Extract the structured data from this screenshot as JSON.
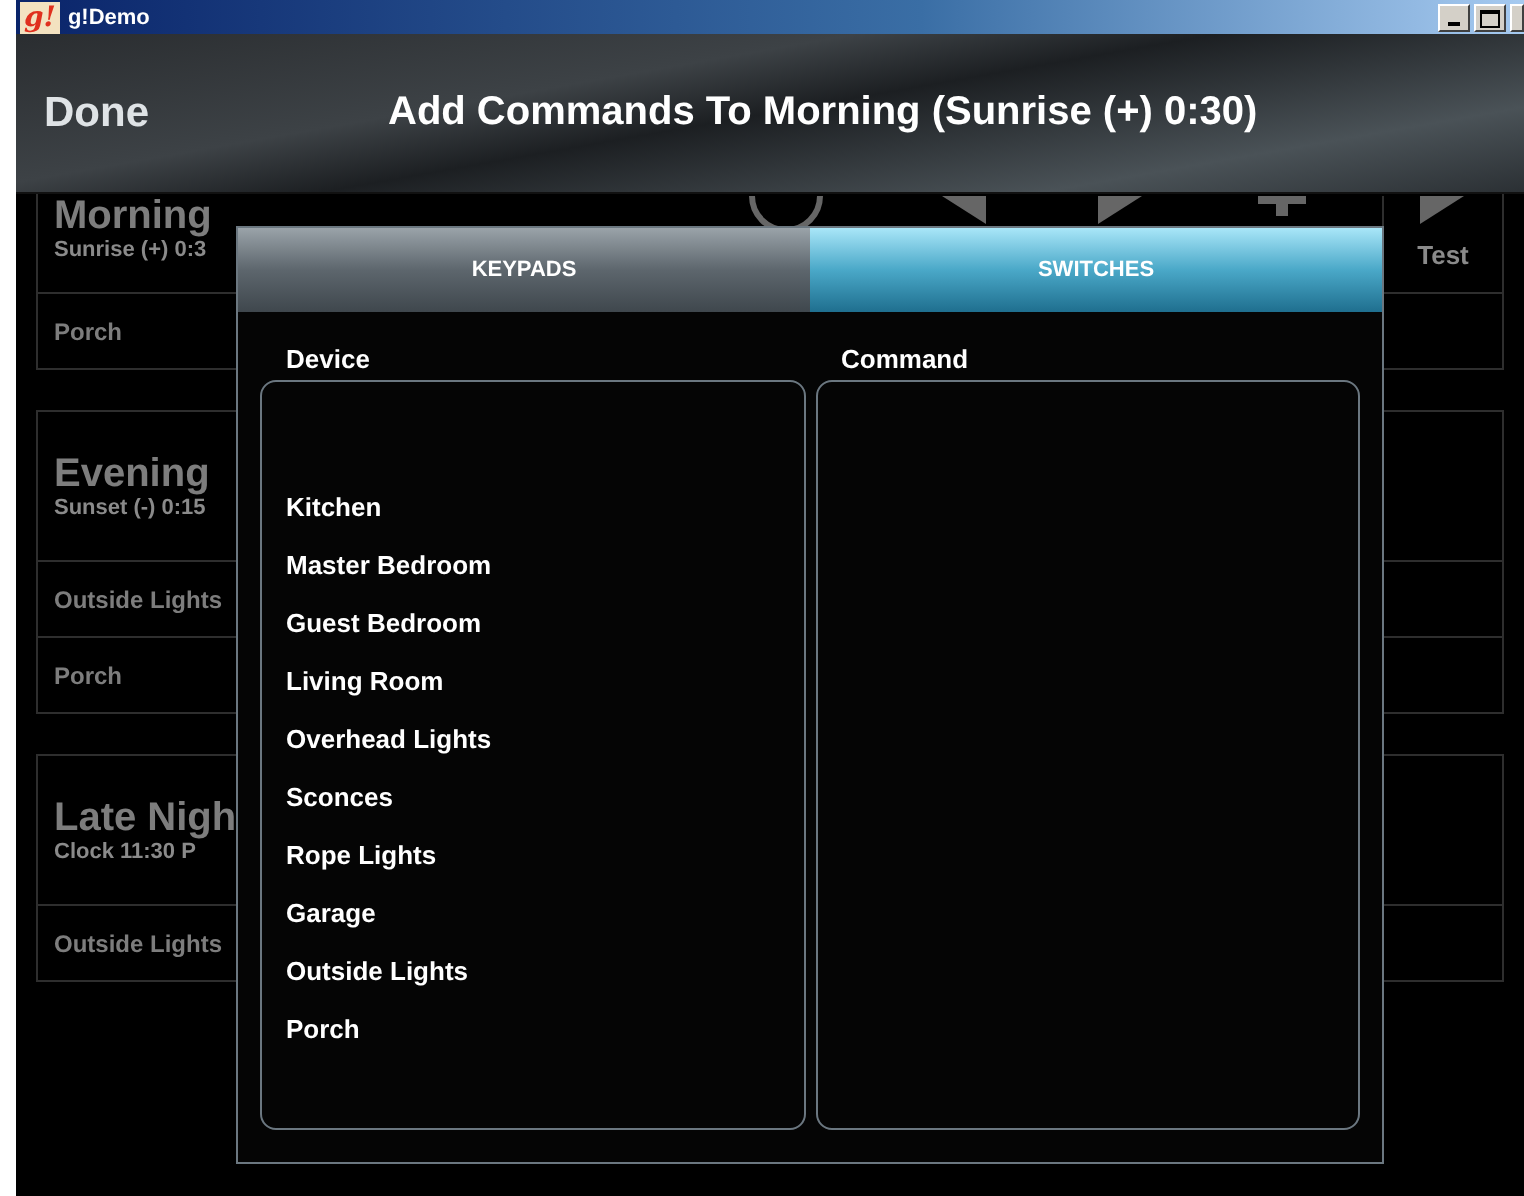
{
  "window": {
    "logo_text": "g!",
    "title": "g!Demo"
  },
  "header": {
    "done_button": "Done",
    "title": "Add Commands To Morning (Sunrise (+) 0:30)"
  },
  "schedules": [
    {
      "name": "Morning",
      "trigger": "Sunrise (+) 0:3",
      "commands": [
        "Porch"
      ],
      "toolbar": {
        "test_button": "Test"
      }
    },
    {
      "name": "Evening",
      "trigger": "Sunset (-) 0:15",
      "commands": [
        "Outside Lights",
        "Porch"
      ]
    },
    {
      "name": "Late Nigh",
      "trigger": "Clock 11:30  P",
      "commands": [
        "Outside Lights"
      ]
    }
  ],
  "dialog": {
    "tabs": [
      {
        "label": "KEYPADS",
        "selected": false
      },
      {
        "label": "SWITCHES",
        "selected": true
      }
    ],
    "device_heading": "Device",
    "command_heading": "Command",
    "devices": [
      "Kitchen",
      "Master Bedroom",
      "Guest Bedroom",
      "Living Room",
      "Overhead Lights",
      "Sconces",
      "Rope Lights",
      "Garage",
      "Outside Lights",
      "Porch"
    ]
  }
}
